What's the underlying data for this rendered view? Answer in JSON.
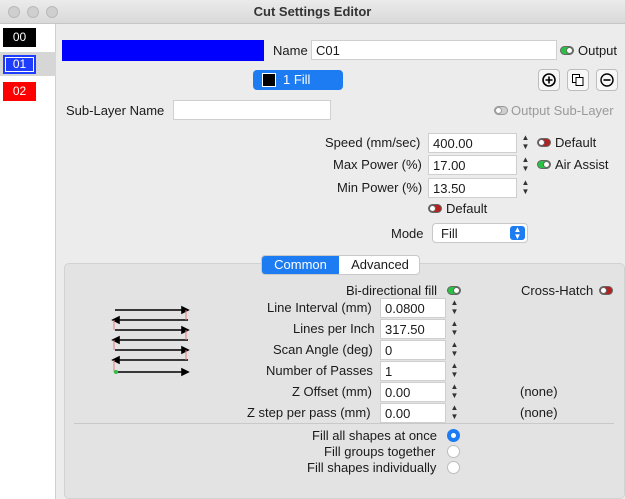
{
  "window": {
    "title": "Cut Settings Editor"
  },
  "layers": [
    {
      "id": "00",
      "color": "#000000"
    },
    {
      "id": "01",
      "color": "#1f3dff"
    },
    {
      "id": "02",
      "color": "#ff0000"
    }
  ],
  "header": {
    "swatch_color": "#0000ff",
    "name_label": "Name",
    "name_value": "C01",
    "output_label": "Output",
    "fill_button": "1 Fill"
  },
  "sublayer": {
    "label": "Sub-Layer Name",
    "value": "",
    "output_label": "Output Sub-Layer"
  },
  "speed": {
    "label": "Speed (mm/sec)",
    "value": "400.00",
    "default_label": "Default"
  },
  "max_power": {
    "label": "Max Power (%)",
    "value": "17.00",
    "air_assist_label": "Air Assist"
  },
  "min_power": {
    "label": "Min Power (%)",
    "value": "13.50"
  },
  "power_default": {
    "label": "Default"
  },
  "mode": {
    "label": "Mode",
    "value": "Fill"
  },
  "tabs": {
    "common": "Common",
    "advanced": "Advanced"
  },
  "fill": {
    "bidirectional_label": "Bi-directional fill",
    "crosshatch_label": "Cross-Hatch",
    "line_interval": {
      "label": "Line Interval (mm)",
      "value": "0.0800"
    },
    "lines_per_inch": {
      "label": "Lines per Inch",
      "value": "317.50"
    },
    "scan_angle": {
      "label": "Scan Angle (deg)",
      "value": "0"
    },
    "passes": {
      "label": "Number of Passes",
      "value": "1"
    },
    "z_offset": {
      "label": "Z Offset (mm)",
      "value": "0.00",
      "note": "(none)"
    },
    "z_step": {
      "label": "Z step per pass (mm)",
      "value": "0.00",
      "note": "(none)"
    },
    "options": [
      {
        "label": "Fill all shapes at once",
        "selected": true
      },
      {
        "label": "Fill groups together",
        "selected": false
      },
      {
        "label": "Fill shapes individually",
        "selected": false
      }
    ]
  },
  "colors": {
    "accent": "#1e7cf2",
    "toggle_on": "#2bc142",
    "toggle_off": "#b22222"
  }
}
